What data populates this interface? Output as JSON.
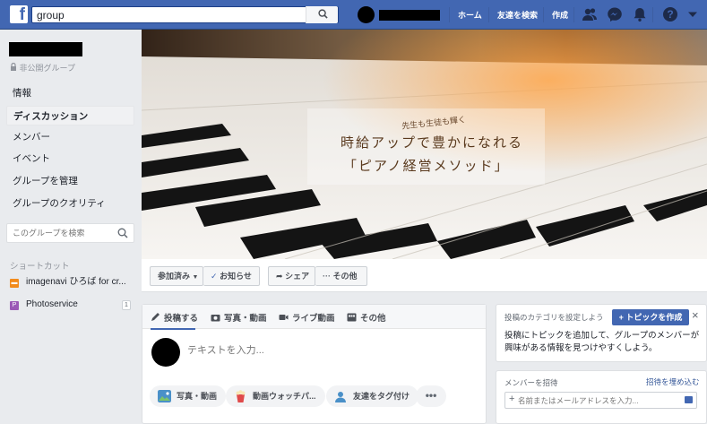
{
  "topbar": {
    "logo": "f",
    "search_value": "group",
    "nav": {
      "home": "ホーム",
      "find_friends": "友達を検索",
      "create": "作成"
    },
    "icons": [
      "friend-requests-icon",
      "messenger-icon",
      "notifications-icon",
      "help-icon",
      "account-menu-icon"
    ]
  },
  "sidebar": {
    "privacy": "非公開グループ",
    "items": [
      {
        "label": "情報"
      },
      {
        "label": "ディスカッション",
        "active": true
      },
      {
        "label": "メンバー"
      },
      {
        "label": "イベント"
      },
      {
        "label": "グループを管理"
      },
      {
        "label": "グループのクオリティ"
      }
    ],
    "search_placeholder": "このグループを検索",
    "shortcut_title": "ショートカット",
    "shortcuts": [
      {
        "label": "imagenavi ひろば for cr...",
        "icon": "imagenavi-icon",
        "color": "#f28b1c"
      },
      {
        "label": "Photoservice",
        "icon": "photoservice-icon",
        "color": "#9b59b6",
        "count": "1"
      }
    ]
  },
  "cover": {
    "small": "先生も生徒も輝く",
    "line1": "時給アップで豊かになれる",
    "line2": "「ピアノ経営メソッド」"
  },
  "actions": {
    "joined": "参加済み",
    "notifications": "お知らせ",
    "share": "シェア",
    "more": "その他"
  },
  "composer": {
    "tabs": [
      "投稿する",
      "写真・動画",
      "ライブ動画",
      "その他"
    ],
    "placeholder": "テキストを入力...",
    "buttons": [
      "写真・動画",
      "動画ウォッチパ...",
      "友達をタグ付け"
    ],
    "more": "•••"
  },
  "topic_card": {
    "title": "投稿のカテゴリを設定しよう",
    "button": "+ トピックを作成",
    "close": "×",
    "body": "投稿にトピックを追加して、グループのメンバーが興味がある情報を見つけやすくしよう。"
  },
  "invite_card": {
    "title": "メンバーを招待",
    "embed": "招待を埋め込む",
    "placeholder": "名前またはメールアドレスを入力..."
  },
  "colors": {
    "facebook_blue": "#4267b2",
    "background": "#e9ebee"
  }
}
